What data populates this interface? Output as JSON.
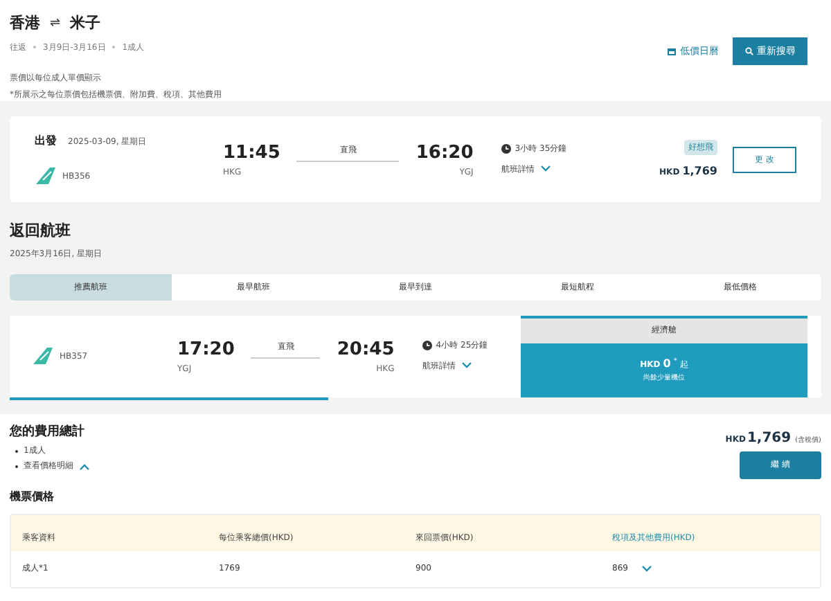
{
  "header": {
    "origin": "香港",
    "swap": "⇌",
    "destination": "米子",
    "trip": [
      "往返",
      "3月9日-3月16日",
      "1成人"
    ],
    "notes": [
      "票價以每位成人單價顯示",
      "*所展示之每位票價包括機票價、附加費、稅項、其他費用"
    ],
    "calendar_link": "低價日曆",
    "search_button": "重新搜尋"
  },
  "outbound": {
    "label": "出發",
    "date": "2025-03-09, 星期日",
    "flight": "HB356",
    "depart_time": "11:45",
    "depart_code": "HKG",
    "stops": "直飛",
    "arrive_time": "16:20",
    "arrive_code": "YGJ",
    "duration": "3小時 35分鐘",
    "details": "航班詳情",
    "badge": "好想飛",
    "currency": "HKD",
    "price": "1,769",
    "change_button": "更 改"
  },
  "return": {
    "title": "返回航班",
    "date": "2025年3月16日, 星期日",
    "tabs": [
      {
        "label": "推薦航班",
        "selected": true
      },
      {
        "label": "最早航班",
        "selected": false
      },
      {
        "label": "最早到達",
        "selected": false
      },
      {
        "label": "最短航程",
        "selected": false
      },
      {
        "label": "最低價格",
        "selected": false
      }
    ],
    "flight": {
      "flight": "HB357",
      "depart_time": "17:20",
      "depart_code": "YGJ",
      "stops": "直飛",
      "arrive_time": "20:45",
      "arrive_code": "HKG",
      "duration": "4小時 25分鐘",
      "details": "航班詳情",
      "cabin": "經濟艙",
      "currency": "HKD",
      "price": "0",
      "mark": "*",
      "suffix": "起",
      "seats": "尚餘少量機位"
    }
  },
  "summary": {
    "title": "您的費用總計",
    "items": [
      {
        "label": "1成人",
        "kind": "text"
      },
      {
        "label": "查看價格明細",
        "kind": "toggle",
        "expanded": true
      }
    ],
    "currency": "HKD",
    "total": "1,769",
    "total_note": "(含稅價)",
    "continue_button": "繼 續"
  },
  "fares": {
    "title": "機票價格",
    "columns": [
      {
        "label": "乘客資料",
        "kind": "plain"
      },
      {
        "label": "每位乘客總價(HKD)",
        "kind": "plain"
      },
      {
        "label": "來回票價(HKD)",
        "kind": "plain"
      },
      {
        "label": "稅項及其他費用(HKD)",
        "kind": "link"
      }
    ],
    "rows": [
      {
        "cells": [
          "成人*1",
          "1769",
          "900",
          "869"
        ],
        "expanded": false
      }
    ]
  }
}
